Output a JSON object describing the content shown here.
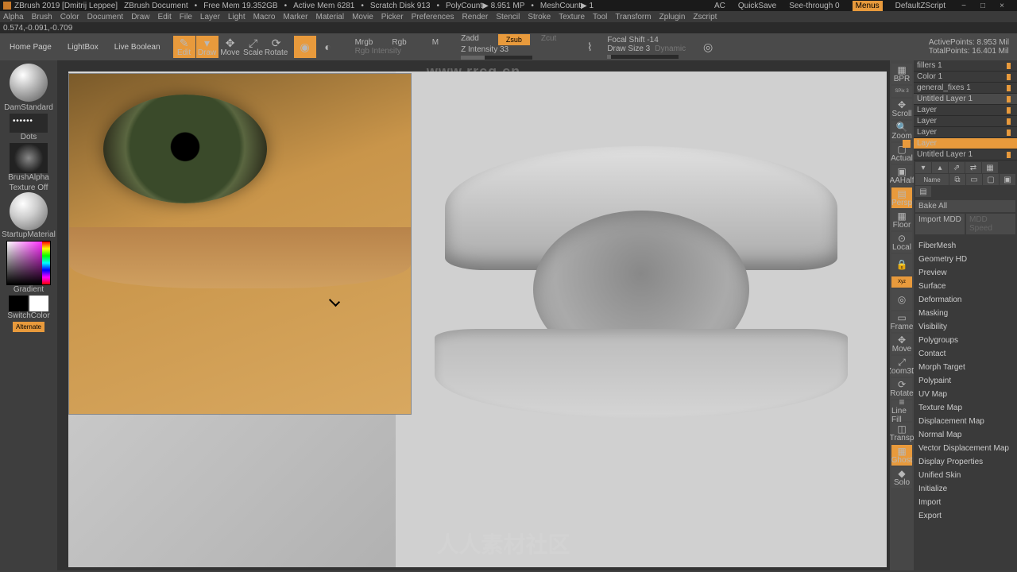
{
  "titlebar": {
    "app": "ZBrush 2019 [Dmitrij Leppee]",
    "doc": "ZBrush Document",
    "mem": "Free Mem 19.352GB",
    "active": "Active Mem 6281",
    "scratch": "Scratch Disk 913",
    "poly": "PolyCount▶ 8.951 MP",
    "mesh": "MeshCount▶ 1",
    "ac": "AC",
    "quicksave": "QuickSave",
    "seethrough": "See-through  0",
    "menus": "Menus",
    "defaultz": "DefaultZScript"
  },
  "menus": [
    "Alpha",
    "Brush",
    "Color",
    "Document",
    "Draw",
    "Edit",
    "File",
    "Layer",
    "Light",
    "Macro",
    "Marker",
    "Material",
    "Movie",
    "Picker",
    "Preferences",
    "Render",
    "Stencil",
    "Stroke",
    "Texture",
    "Tool",
    "Transform",
    "Zplugin",
    "Zscript"
  ],
  "coords": "0.574,-0.091,-0.709",
  "toolbar": {
    "home": "Home Page",
    "lightbox": "LightBox",
    "liveboolean": "Live Boolean",
    "edit": "Edit",
    "draw": "Draw",
    "move": "Move",
    "scale": "Scale",
    "rotate": "Rotate",
    "mrgb": "Mrgb",
    "rgb": "Rgb",
    "m": "M",
    "rgbint": "Rgb Intensity",
    "zadd": "Zadd",
    "zsub": "Zsub",
    "zcut": "Zcut",
    "zint": "Z Intensity 33",
    "focal": "Focal Shift -14",
    "drawsize": "Draw Size 3",
    "dynamic": "Dynamic",
    "activepts": "ActivePoints: 8.953 Mil",
    "totalpts": "TotalPoints: 16.401 Mil"
  },
  "shelf": {
    "brush": "DamStandard",
    "stroke": "Dots",
    "alpha": "BrushAlpha",
    "texture": "Texture Off",
    "material": "StartupMaterial",
    "gradient": "Gradient",
    "switchcolor": "SwitchColor",
    "alternate": "Alternate"
  },
  "dock": {
    "bpr": "BPR",
    "spix": "SPix 3",
    "scroll": "Scroll",
    "zoom": "Zoom",
    "actual": "Actual",
    "aahalf": "AAHalf",
    "persp": "Persp",
    "floor": "Floor",
    "local": "Local",
    "lock": "",
    "xyz": "Xyz",
    "frame": "Frame",
    "move": "Move",
    "zoom3d": "Zoom3D",
    "rotate": "Rotate",
    "linefill": "Line Fill",
    "transp": "Transp",
    "ghost": "Ghost",
    "solo": "Solo"
  },
  "layers": {
    "list": [
      {
        "name": "fillers 1"
      },
      {
        "name": "Color 1"
      },
      {
        "name": "general_fixes 1"
      },
      {
        "name": "Untitled Layer 1",
        "sel": true
      },
      {
        "name": "Layer"
      },
      {
        "name": "Layer"
      },
      {
        "name": "Layer"
      },
      {
        "name": "Layer",
        "hl": true
      }
    ],
    "current": "Untitled Layer 1",
    "name_label": "Name",
    "bakeall": "Bake All",
    "importmdd": "Import MDD",
    "mddspeed": "MDD Speed"
  },
  "panels": [
    "FiberMesh",
    "Geometry HD",
    "Preview",
    "Surface",
    "Deformation",
    "Masking",
    "Visibility",
    "Polygroups",
    "Contact",
    "Morph Target",
    "Polypaint",
    "UV Map",
    "Texture Map",
    "Displacement Map",
    "Normal Map",
    "Vector Displacement Map",
    "Display Properties",
    "Unified Skin",
    "Initialize",
    "Import",
    "Export"
  ],
  "watermark": "www.rrcg.cn",
  "watermark2": "人人素材社区"
}
